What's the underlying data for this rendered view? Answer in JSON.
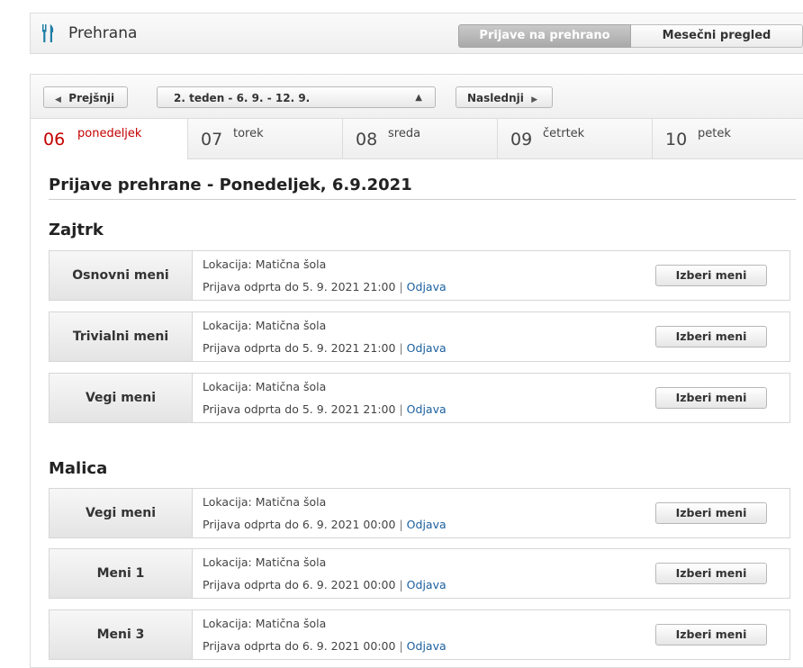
{
  "header": {
    "title": "Prehrana",
    "tabs": [
      {
        "label": "Prijave na prehrano",
        "active": true
      },
      {
        "label": "Mesečni pregled",
        "active": false
      }
    ]
  },
  "nav": {
    "prev_label": "Prejšnji",
    "week_value": "2. teden - 6. 9. - 12. 9.",
    "next_label": "Naslednji"
  },
  "days": [
    {
      "num": "06",
      "name": "ponedeljek",
      "active": true
    },
    {
      "num": "07",
      "name": "torek",
      "active": false
    },
    {
      "num": "08",
      "name": "sreda",
      "active": false
    },
    {
      "num": "09",
      "name": "četrtek",
      "active": false
    },
    {
      "num": "10",
      "name": "petek",
      "active": false
    }
  ],
  "page_heading": "Prijave prehrane - Ponedeljek, 6.9.2021",
  "sections": [
    {
      "title": "Zajtrk",
      "rows": [
        {
          "menu": "Osnovni meni",
          "location": "Lokacija: Matična šola",
          "deadline": "Prijava odprta do 5. 9. 2021 21:00",
          "sep": "|",
          "link": "Odjava",
          "button": "Izberi meni"
        },
        {
          "menu": "Trivialni meni",
          "location": "Lokacija: Matična šola",
          "deadline": "Prijava odprta do 5. 9. 2021 21:00",
          "sep": "|",
          "link": "Odjava",
          "button": "Izberi meni"
        },
        {
          "menu": "Vegi meni",
          "location": "Lokacija: Matična šola",
          "deadline": "Prijava odprta do 5. 9. 2021 21:00",
          "sep": "|",
          "link": "Odjava",
          "button": "Izberi meni"
        }
      ]
    },
    {
      "title": "Malica",
      "rows": [
        {
          "menu": "Vegi meni",
          "location": "Lokacija: Matična šola",
          "deadline": "Prijava odprta do 6. 9. 2021 00:00",
          "sep": "|",
          "link": "Odjava",
          "button": "Izberi meni"
        },
        {
          "menu": "Meni 1",
          "location": "Lokacija: Matična šola",
          "deadline": "Prijava odprta do 6. 9. 2021 00:00",
          "sep": "|",
          "link": "Odjava",
          "button": "Izberi meni"
        },
        {
          "menu": "Meni 3",
          "location": "Lokacija: Matična šola",
          "deadline": "Prijava odprta do 6. 9. 2021 00:00",
          "sep": "|",
          "link": "Odjava",
          "button": "Izberi meni"
        }
      ]
    }
  ],
  "colors": {
    "accent": "#c40000",
    "link": "#1a5f9e"
  }
}
